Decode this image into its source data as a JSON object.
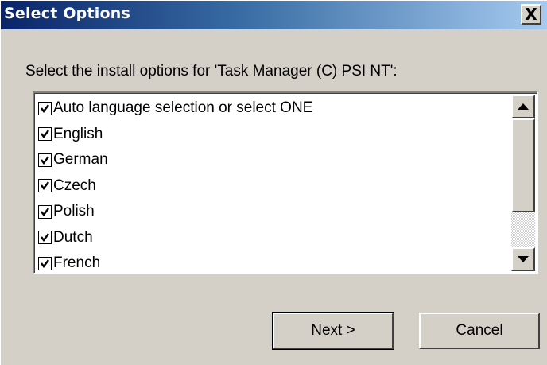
{
  "window": {
    "title": "Select Options",
    "close_glyph": "X"
  },
  "prompt": "Select the install options for 'Task Manager (C) PSI NT':",
  "options": [
    {
      "label": "Auto language selection or select ONE",
      "checked": true
    },
    {
      "label": "English",
      "checked": true
    },
    {
      "label": "German",
      "checked": true
    },
    {
      "label": "Czech",
      "checked": true
    },
    {
      "label": "Polish",
      "checked": true
    },
    {
      "label": "Dutch",
      "checked": true
    },
    {
      "label": "French",
      "checked": true
    }
  ],
  "buttons": {
    "next_label": "Next >",
    "cancel_label": "Cancel"
  },
  "icons": {
    "check": "checkmark-icon",
    "scroll_up": "arrow-up-icon",
    "scroll_down": "arrow-down-icon",
    "close": "close-icon"
  },
  "colors": {
    "title_start": "#0a246a",
    "title_end": "#a6caf0",
    "face": "#d4d0c8"
  }
}
